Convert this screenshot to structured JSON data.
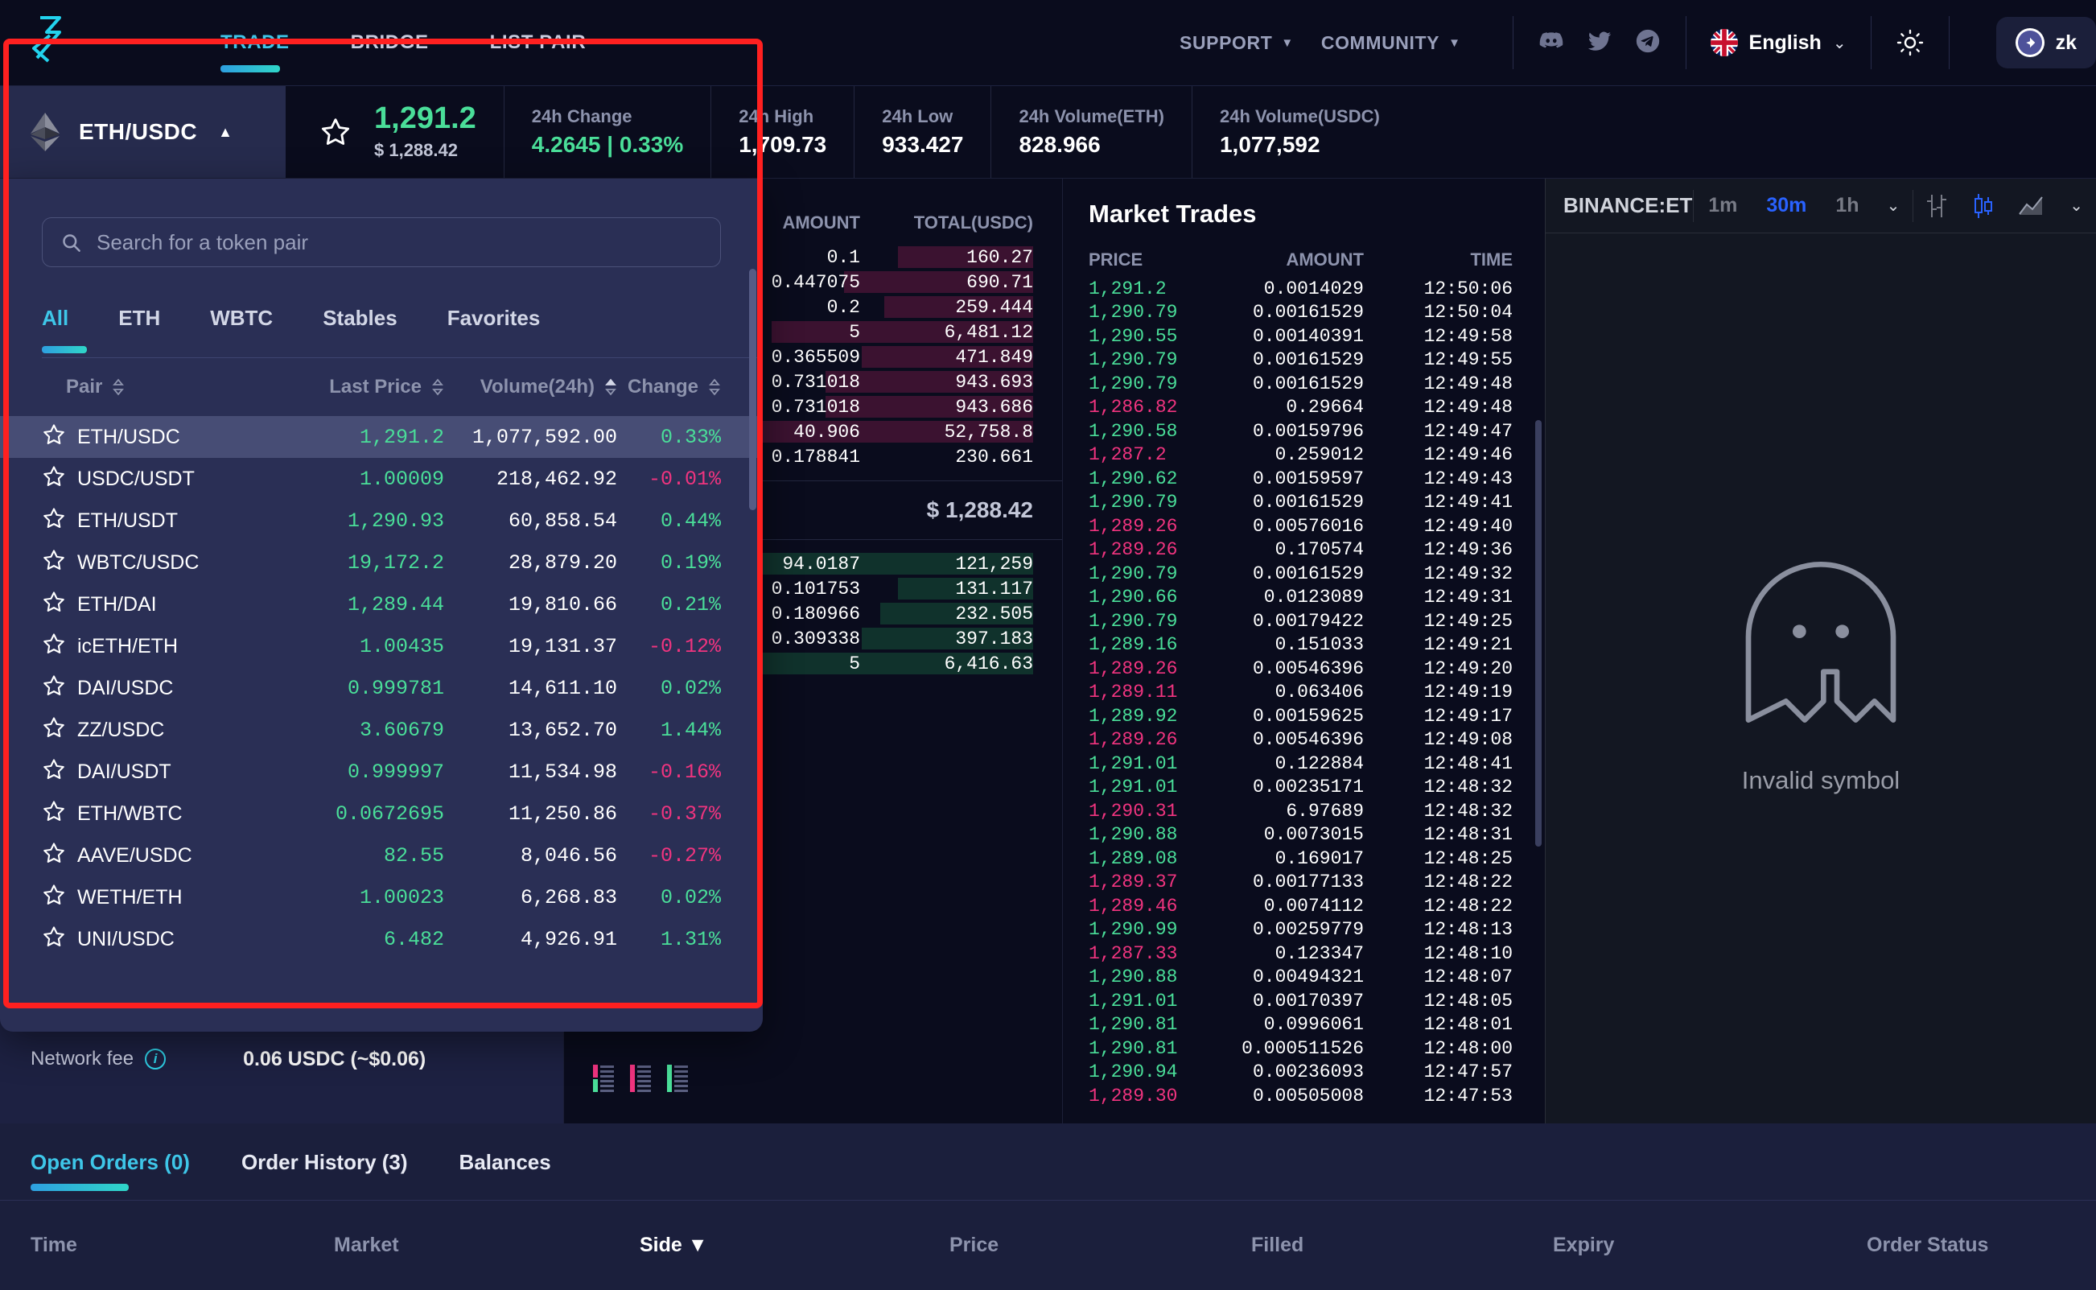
{
  "nav": {
    "links": [
      {
        "label": "TRADE",
        "active": true
      },
      {
        "label": "BRIDGE",
        "active": false
      },
      {
        "label": "LIST PAIR",
        "active": false
      }
    ],
    "support": "SUPPORT",
    "community": "COMMUNITY",
    "language": "English",
    "wallet": "zk",
    "icons": [
      "discord-icon",
      "twitter-icon",
      "telegram-icon",
      "sun-icon"
    ]
  },
  "market": {
    "pair": "ETH/USDC",
    "last_price": "1,291.2",
    "last_price_usd": "$ 1,288.42",
    "stats": [
      {
        "label": "24h Change",
        "value": "4.2645 | 0.33%",
        "positive": true
      },
      {
        "label": "24h High",
        "value": "1,709.73",
        "positive": false
      },
      {
        "label": "24h Low",
        "value": "933.427",
        "positive": false
      },
      {
        "label": "24h Volume(ETH)",
        "value": "828.966",
        "positive": false
      },
      {
        "label": "24h Volume(USDC)",
        "value": "1,077,592",
        "positive": false
      }
    ]
  },
  "dropdown": {
    "search_placeholder": "Search for a token pair",
    "search_value": "",
    "filters": [
      {
        "label": "All",
        "active": true
      },
      {
        "label": "ETH",
        "active": false
      },
      {
        "label": "WBTC",
        "active": false
      },
      {
        "label": "Stables",
        "active": false
      },
      {
        "label": "Favorites",
        "active": false
      }
    ],
    "columns": [
      "Pair",
      "Last Price",
      "Volume(24h)",
      "Change"
    ],
    "rows": [
      {
        "pair": "ETH/USDC",
        "last": "1,291.2",
        "vol": "1,077,592.00",
        "chg": "0.33%",
        "dir": "up",
        "selected": true
      },
      {
        "pair": "USDC/USDT",
        "last": "1.00009",
        "vol": "218,462.92",
        "chg": "-0.01%",
        "dir": "down",
        "selected": false
      },
      {
        "pair": "ETH/USDT",
        "last": "1,290.93",
        "vol": "60,858.54",
        "chg": "0.44%",
        "dir": "up",
        "selected": false
      },
      {
        "pair": "WBTC/USDC",
        "last": "19,172.2",
        "vol": "28,879.20",
        "chg": "0.19%",
        "dir": "up",
        "selected": false
      },
      {
        "pair": "ETH/DAI",
        "last": "1,289.44",
        "vol": "19,810.66",
        "chg": "0.21%",
        "dir": "up",
        "selected": false
      },
      {
        "pair": "icETH/ETH",
        "last": "1.00435",
        "vol": "19,131.37",
        "chg": "-0.12%",
        "dir": "down",
        "selected": false
      },
      {
        "pair": "DAI/USDC",
        "last": "0.999781",
        "vol": "14,611.10",
        "chg": "0.02%",
        "dir": "up",
        "selected": false
      },
      {
        "pair": "ZZ/USDC",
        "last": "3.60679",
        "vol": "13,652.70",
        "chg": "1.44%",
        "dir": "up",
        "selected": false
      },
      {
        "pair": "DAI/USDT",
        "last": "0.999997",
        "vol": "11,534.98",
        "chg": "-0.16%",
        "dir": "down",
        "selected": false
      },
      {
        "pair": "ETH/WBTC",
        "last": "0.0672695",
        "vol": "11,250.86",
        "chg": "-0.37%",
        "dir": "down",
        "selected": false
      },
      {
        "pair": "AAVE/USDC",
        "last": "82.55",
        "vol": "8,046.56",
        "chg": "-0.27%",
        "dir": "down",
        "selected": false
      },
      {
        "pair": "WETH/ETH",
        "last": "1.00023",
        "vol": "6,268.83",
        "chg": "0.02%",
        "dir": "up",
        "selected": false
      },
      {
        "pair": "UNI/USDC",
        "last": "6.482",
        "vol": "4,926.91",
        "chg": "1.31%",
        "dir": "up",
        "selected": false
      }
    ]
  },
  "orderbook": {
    "columns": [
      "AMOUNT",
      "TOTAL(USDC)"
    ],
    "asks": [
      {
        "amount": "0.1",
        "total": "160.27",
        "bar": 30
      },
      {
        "amount": "0.447075",
        "total": "690.71",
        "bar": 42
      },
      {
        "amount": "0.2",
        "total": "259.444",
        "bar": 33
      },
      {
        "amount": "5",
        "total": "6,481.12",
        "bar": 58
      },
      {
        "amount": "0.365509",
        "total": "471.849",
        "bar": 38
      },
      {
        "amount": "0.731018",
        "total": "943.693",
        "bar": 46
      },
      {
        "amount": "0.731018",
        "total": "943.686",
        "bar": 46
      },
      {
        "amount": "40.906",
        "total": "52,758.8",
        "bar": 72
      }
    ],
    "spread_row": {
      "amount": "0.178841",
      "total": "230.661"
    },
    "mid_price": "$ 1,288.42",
    "bids": [
      {
        "amount": "94.0187",
        "total": "121,259",
        "bar": 74
      },
      {
        "amount": "0.101753",
        "total": "131.117",
        "bar": 30
      },
      {
        "amount": "0.180966",
        "total": "232.505",
        "bar": 34
      },
      {
        "amount": "0.309338",
        "total": "397.183",
        "bar": 38
      },
      {
        "amount": "5",
        "total": "6,416.63",
        "bar": 60
      }
    ]
  },
  "trades": {
    "title": "Market Trades",
    "columns": [
      "PRICE",
      "AMOUNT",
      "TIME"
    ],
    "rows": [
      {
        "price": "1,291.2",
        "amount": "0.0014029",
        "time": "12:50:06",
        "dir": "up"
      },
      {
        "price": "1,290.79",
        "amount": "0.00161529",
        "time": "12:50:04",
        "dir": "up"
      },
      {
        "price": "1,290.55",
        "amount": "0.00140391",
        "time": "12:49:58",
        "dir": "up"
      },
      {
        "price": "1,290.79",
        "amount": "0.00161529",
        "time": "12:49:55",
        "dir": "up"
      },
      {
        "price": "1,290.79",
        "amount": "0.00161529",
        "time": "12:49:48",
        "dir": "up"
      },
      {
        "price": "1,286.82",
        "amount": "0.29664",
        "time": "12:49:48",
        "dir": "down"
      },
      {
        "price": "1,290.58",
        "amount": "0.00159796",
        "time": "12:49:47",
        "dir": "up"
      },
      {
        "price": "1,287.2",
        "amount": "0.259012",
        "time": "12:49:46",
        "dir": "down"
      },
      {
        "price": "1,290.62",
        "amount": "0.00159597",
        "time": "12:49:43",
        "dir": "up"
      },
      {
        "price": "1,290.79",
        "amount": "0.00161529",
        "time": "12:49:41",
        "dir": "up"
      },
      {
        "price": "1,289.26",
        "amount": "0.00576016",
        "time": "12:49:40",
        "dir": "down"
      },
      {
        "price": "1,289.26",
        "amount": "0.170574",
        "time": "12:49:36",
        "dir": "down"
      },
      {
        "price": "1,290.79",
        "amount": "0.00161529",
        "time": "12:49:32",
        "dir": "up"
      },
      {
        "price": "1,290.66",
        "amount": "0.0123089",
        "time": "12:49:31",
        "dir": "up"
      },
      {
        "price": "1,290.79",
        "amount": "0.00179422",
        "time": "12:49:25",
        "dir": "up"
      },
      {
        "price": "1,289.16",
        "amount": "0.151033",
        "time": "12:49:21",
        "dir": "up"
      },
      {
        "price": "1,289.26",
        "amount": "0.00546396",
        "time": "12:49:20",
        "dir": "down"
      },
      {
        "price": "1,289.11",
        "amount": "0.063406",
        "time": "12:49:19",
        "dir": "down"
      },
      {
        "price": "1,289.92",
        "amount": "0.00159625",
        "time": "12:49:17",
        "dir": "up"
      },
      {
        "price": "1,289.26",
        "amount": "0.00546396",
        "time": "12:49:08",
        "dir": "down"
      },
      {
        "price": "1,291.01",
        "amount": "0.122884",
        "time": "12:48:41",
        "dir": "up"
      },
      {
        "price": "1,291.01",
        "amount": "0.00235171",
        "time": "12:48:32",
        "dir": "up"
      },
      {
        "price": "1,290.31",
        "amount": "6.97689",
        "time": "12:48:32",
        "dir": "down"
      },
      {
        "price": "1,290.88",
        "amount": "0.0073015",
        "time": "12:48:31",
        "dir": "up"
      },
      {
        "price": "1,289.08",
        "amount": "0.169017",
        "time": "12:48:25",
        "dir": "up"
      },
      {
        "price": "1,289.37",
        "amount": "0.00177133",
        "time": "12:48:22",
        "dir": "down"
      },
      {
        "price": "1,289.46",
        "amount": "0.0074112",
        "time": "12:48:22",
        "dir": "down"
      },
      {
        "price": "1,290.99",
        "amount": "0.00259779",
        "time": "12:48:13",
        "dir": "up"
      },
      {
        "price": "1,287.33",
        "amount": "0.123347",
        "time": "12:48:10",
        "dir": "down"
      },
      {
        "price": "1,290.88",
        "amount": "0.00494321",
        "time": "12:48:07",
        "dir": "up"
      },
      {
        "price": "1,291.01",
        "amount": "0.00170397",
        "time": "12:48:05",
        "dir": "up"
      },
      {
        "price": "1,290.81",
        "amount": "0.0996061",
        "time": "12:48:01",
        "dir": "up"
      },
      {
        "price": "1,290.81",
        "amount": "0.000511526",
        "time": "12:48:00",
        "dir": "up"
      },
      {
        "price": "1,290.94",
        "amount": "0.00236093",
        "time": "12:47:57",
        "dir": "up"
      },
      {
        "price": "1,289.30",
        "amount": "0.00505008",
        "time": "12:47:53",
        "dir": "down"
      }
    ]
  },
  "chart": {
    "symbol": "BINANCE:ETH",
    "timeframes": [
      {
        "label": "1m",
        "active": false
      },
      {
        "label": "30m",
        "active": true
      },
      {
        "label": "1h",
        "active": false
      }
    ],
    "empty_message": "Invalid symbol"
  },
  "trade_panel": {
    "network_fee_label": "Network fee",
    "network_fee_value": "0.06 USDC (~$0.06)"
  },
  "bottom": {
    "tabs": [
      {
        "label": "Open Orders (0)",
        "active": true
      },
      {
        "label": "Order History (3)",
        "active": false
      },
      {
        "label": "Balances",
        "active": false
      }
    ],
    "columns": [
      "Time",
      "Market",
      "Side",
      "Price",
      "Filled",
      "Expiry",
      "Order Status"
    ]
  },
  "colors": {
    "accent": "#3ec6e8",
    "up": "#4ade99",
    "down": "#f0347f",
    "annotation": "#ff2020"
  }
}
